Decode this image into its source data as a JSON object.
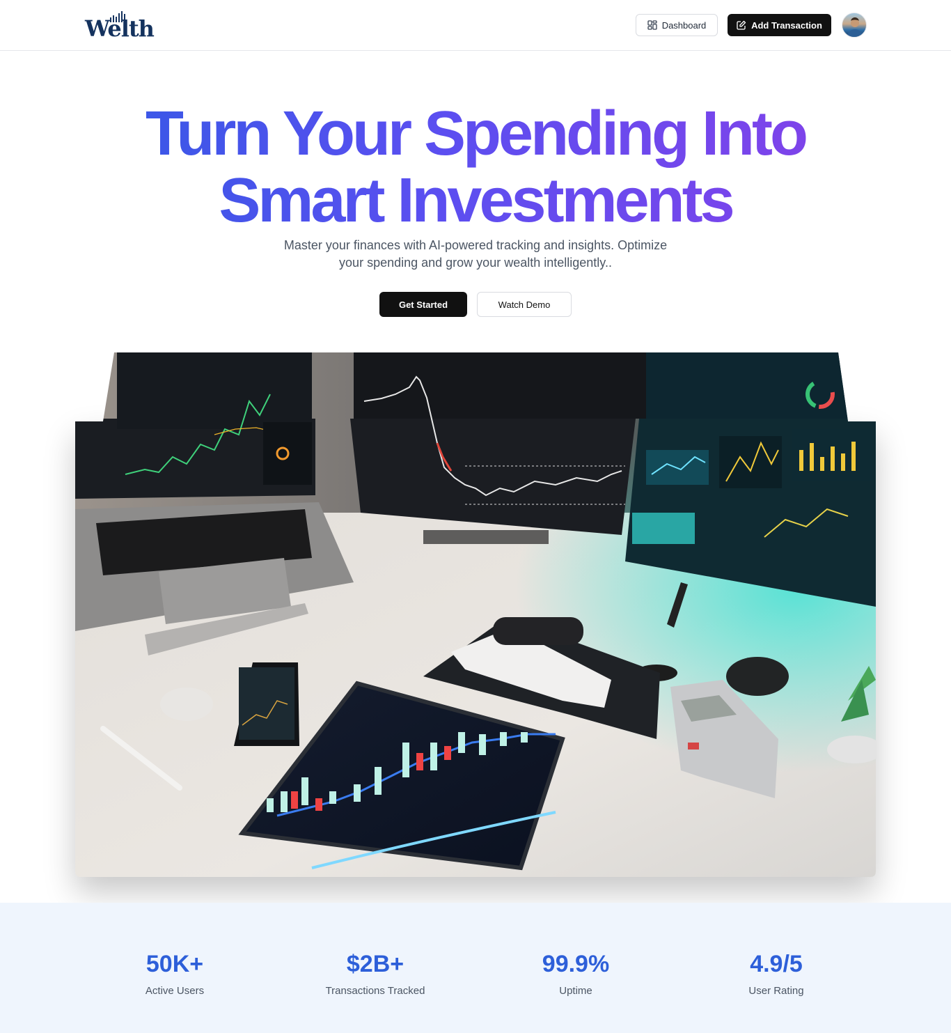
{
  "header": {
    "logo_text": "Welth",
    "dashboard_label": "Dashboard",
    "add_transaction_label": "Add Transaction"
  },
  "hero": {
    "title_line1": "Turn Your Spending Into",
    "title_line2": "Smart Investments",
    "subtitle_line1": "Master your finances with AI-powered tracking and insights. Optimize",
    "subtitle_line2": "your spending and grow your wealth intelligently..",
    "get_started_label": "Get Started",
    "watch_demo_label": "Watch Demo",
    "image_subject": "trading desk with monitors, laptop, tablet and phone showing stock charts"
  },
  "stats": [
    {
      "value": "50K+",
      "label": "Active Users"
    },
    {
      "value": "$2B+",
      "label": "Transactions Tracked"
    },
    {
      "value": "99.9%",
      "label": "Uptime"
    },
    {
      "value": "4.9/5",
      "label": "User Rating"
    }
  ],
  "colors": {
    "gradient_start": "#2d5be3",
    "gradient_end": "#8b3fe8",
    "stat_blue": "#2d5fd9",
    "stats_bg": "#eff5fd",
    "primary_button": "#111111"
  },
  "icons": {
    "dashboard": "layout-dashboard-icon",
    "add": "pen-square-icon"
  }
}
